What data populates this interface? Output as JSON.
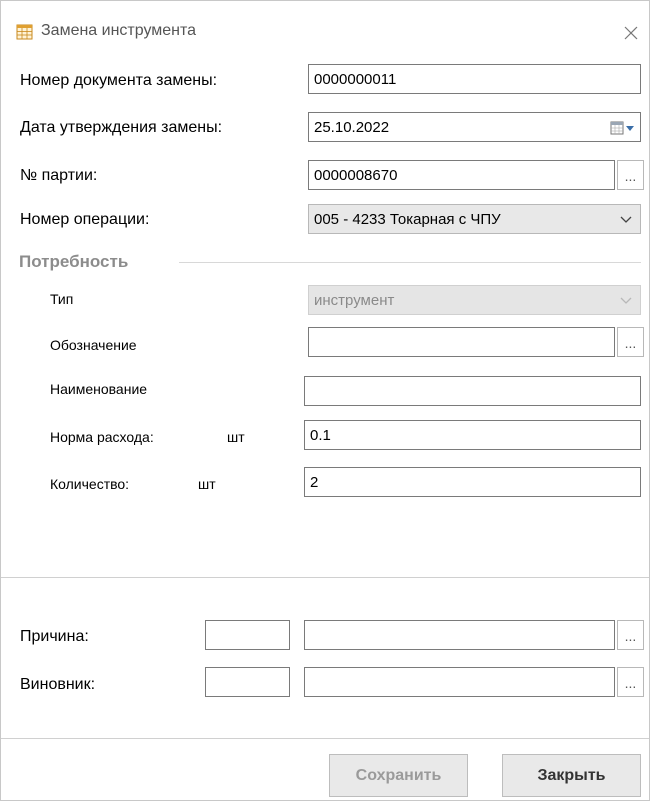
{
  "window": {
    "title": "Замена инструмента",
    "close_glyph": "✕"
  },
  "form": {
    "doc_number": {
      "label": "Номер документа замены:",
      "value": "0000000011"
    },
    "approval_date": {
      "label": "Дата утверждения замены:",
      "value": "25.10.2022"
    },
    "batch_number": {
      "label": "№ партии:",
      "value": "0000008670"
    },
    "operation": {
      "label": "Номер операции:",
      "value": "005 - 4233 Токарная с ЧПУ"
    }
  },
  "need": {
    "section_title": "Потребность",
    "type": {
      "label": "Тип",
      "value": "инструмент"
    },
    "designation": {
      "label": "Обозначение",
      "value": ""
    },
    "name": {
      "label": "Наименование",
      "value": ""
    },
    "consumption_rate": {
      "label": "Норма расхода:",
      "unit": "шт",
      "value": "0.1"
    },
    "quantity": {
      "label": "Количество:",
      "unit": "шт",
      "value": "2"
    }
  },
  "reason": {
    "label": "Причина:",
    "code": "",
    "value": ""
  },
  "culprit": {
    "label": "Виновник:",
    "code": "",
    "value": ""
  },
  "buttons": {
    "dots": "...",
    "save": "Сохранить",
    "close": "Закрыть"
  },
  "icons": {
    "app": "table-calendar-icon",
    "close": "close-icon",
    "calendar": "calendar-dropdown-icon",
    "chevron": "chevron-down-icon"
  },
  "colors": {
    "section_title": "#8c8c8c",
    "disabled_text": "#9a9a9a",
    "button_bg": "#e9e9e9"
  }
}
